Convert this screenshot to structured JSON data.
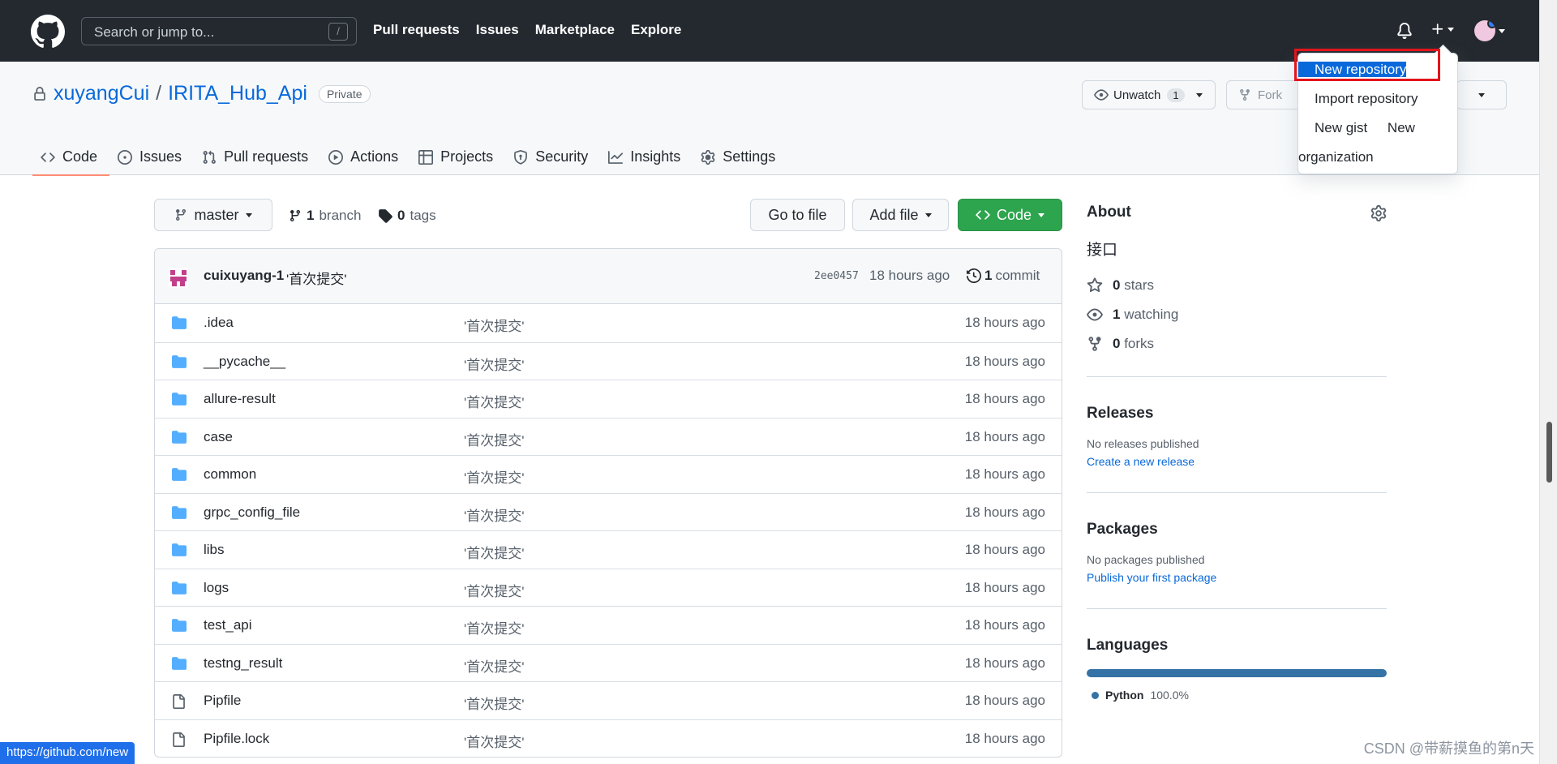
{
  "header": {
    "search_placeholder": "Search or jump to...",
    "search_shortcut": "/",
    "nav": [
      "Pull requests",
      "Issues",
      "Marketplace",
      "Explore"
    ]
  },
  "dropdown": {
    "items": [
      "New repository",
      "Import repository",
      "New gist",
      "New organization"
    ]
  },
  "repo": {
    "owner": "xuyangCui",
    "separator": "/",
    "name": "IRITA_Hub_Api",
    "visibility": "Private",
    "unwatch_label": "Unwatch",
    "unwatch_count": "1",
    "fork_label": "Fork",
    "tabs": [
      "Code",
      "Issues",
      "Pull requests",
      "Actions",
      "Projects",
      "Security",
      "Insights",
      "Settings"
    ]
  },
  "toolbar": {
    "branch": "master",
    "branch_count": "1",
    "branch_label": "branch",
    "tag_count": "0",
    "tag_label": "tags",
    "go_to_file": "Go to file",
    "add_file": "Add file",
    "code": "Code"
  },
  "commit": {
    "author": "cuixuyang-1",
    "message": "'首次提交'",
    "sha": "2ee0457",
    "ago": "18 hours ago",
    "count": "1",
    "count_label": "commit"
  },
  "files": [
    {
      "name": ".idea",
      "type": "dir",
      "message": "'首次提交'",
      "ago": "18 hours ago"
    },
    {
      "name": "__pycache__",
      "type": "dir",
      "message": "'首次提交'",
      "ago": "18 hours ago"
    },
    {
      "name": "allure-result",
      "type": "dir",
      "message": "'首次提交'",
      "ago": "18 hours ago"
    },
    {
      "name": "case",
      "type": "dir",
      "message": "'首次提交'",
      "ago": "18 hours ago"
    },
    {
      "name": "common",
      "type": "dir",
      "message": "'首次提交'",
      "ago": "18 hours ago"
    },
    {
      "name": "grpc_config_file",
      "type": "dir",
      "message": "'首次提交'",
      "ago": "18 hours ago"
    },
    {
      "name": "libs",
      "type": "dir",
      "message": "'首次提交'",
      "ago": "18 hours ago"
    },
    {
      "name": "logs",
      "type": "dir",
      "message": "'首次提交'",
      "ago": "18 hours ago"
    },
    {
      "name": "test_api",
      "type": "dir",
      "message": "'首次提交'",
      "ago": "18 hours ago"
    },
    {
      "name": "testng_result",
      "type": "dir",
      "message": "'首次提交'",
      "ago": "18 hours ago"
    },
    {
      "name": "Pipfile",
      "type": "file",
      "message": "'首次提交'",
      "ago": "18 hours ago"
    },
    {
      "name": "Pipfile.lock",
      "type": "file",
      "message": "'首次提交'",
      "ago": "18 hours ago"
    }
  ],
  "about": {
    "title": "About",
    "description": "接口",
    "stars_count": "0",
    "stars_label": "stars",
    "watching_count": "1",
    "watching_label": "watching",
    "forks_count": "0",
    "forks_label": "forks"
  },
  "releases": {
    "title": "Releases",
    "empty": "No releases published",
    "link": "Create a new release"
  },
  "packages": {
    "title": "Packages",
    "empty": "No packages published",
    "link": "Publish your first package"
  },
  "languages": {
    "title": "Languages",
    "items": [
      {
        "name": "Python",
        "percent": "100.0%",
        "color": "#3572A5"
      }
    ]
  },
  "status_url": "https://github.com/new",
  "watermark": "CSDN @带薪摸鱼的第n天",
  "colors": {
    "header_bg": "#24292f",
    "link": "#0969da",
    "green": "#2da44e",
    "highlight": "#e3141a",
    "folder": "#54aeff"
  }
}
